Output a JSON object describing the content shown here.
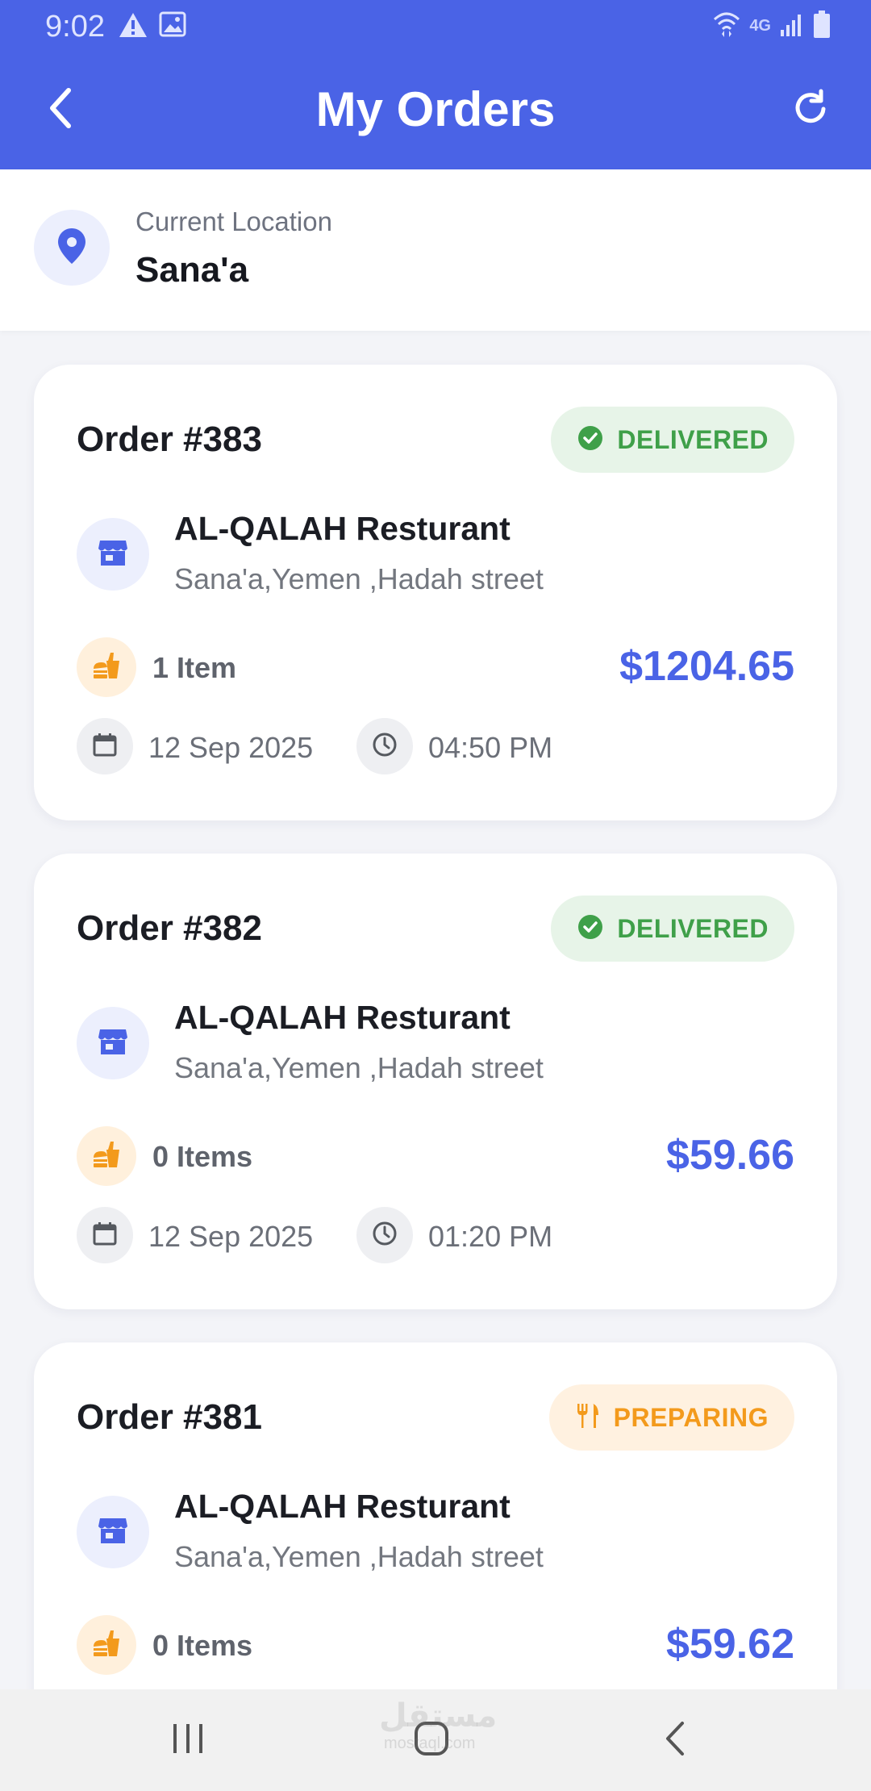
{
  "status_bar": {
    "time": "9:02",
    "network": "4G"
  },
  "app_bar": {
    "title": "My Orders",
    "back_icon": "chevron-left-icon",
    "refresh_icon": "refresh-icon",
    "color": "#4a63e6"
  },
  "location": {
    "label": "Current Location",
    "value": "Sana'a",
    "icon": "map-pin-icon"
  },
  "orders": [
    {
      "number": "Order #383",
      "status": "DELIVERED",
      "restaurant": "AL-QALAH Resturant",
      "address": "Sana'a,Yemen ,Hadah street",
      "items": "1 Item",
      "price": "$1204.65",
      "date": "12 Sep 2025",
      "time": "04:50 PM"
    },
    {
      "number": "Order #382",
      "status": "DELIVERED",
      "restaurant": "AL-QALAH Resturant",
      "address": "Sana'a,Yemen ,Hadah street",
      "items": "0 Items",
      "price": "$59.66",
      "date": "12 Sep 2025",
      "time": "01:20 PM"
    },
    {
      "number": "Order #381",
      "status": "PREPARING",
      "restaurant": "AL-QALAH Resturant",
      "address": "Sana'a,Yemen ,Hadah street",
      "items": "0 Items",
      "price": "$59.62"
    }
  ],
  "status_colors": {
    "delivered": "#3fa049",
    "preparing": "#f39a1c",
    "price": "#4a63e6"
  },
  "watermark": {
    "text": "مستقل",
    "sub": "mostaql.com"
  }
}
